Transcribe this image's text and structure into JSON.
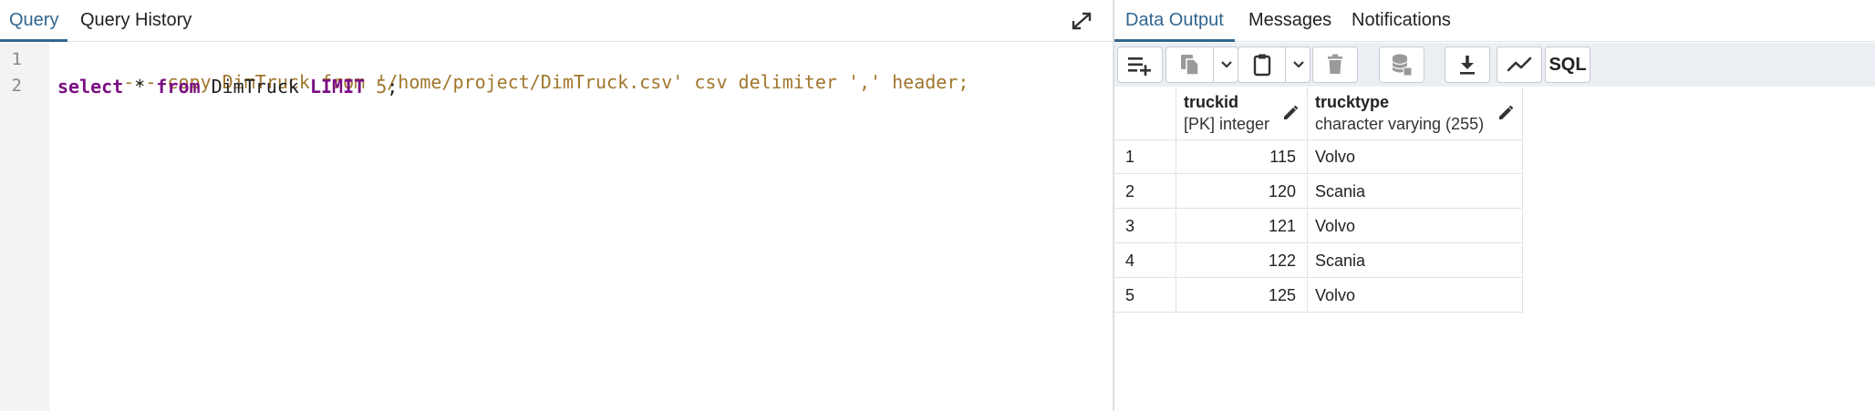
{
  "query_panel": {
    "tabs": [
      {
        "label": "Query",
        "active": true
      },
      {
        "label": "Query History",
        "active": false
      }
    ],
    "expand_icon": "expand-icon"
  },
  "editor": {
    "line_numbers": [
      "1",
      "2"
    ],
    "line1": "--- copy DimTruck from '/home/project/DimTruck.csv' csv delimiter ',' header;",
    "line2": {
      "kw_select": "select",
      "star": " * ",
      "kw_from": "from",
      "table": " DimTruck ",
      "kw_limit": "LIMIT",
      "space": " ",
      "num": "5",
      "semi": ";"
    }
  },
  "output_panel": {
    "tabs": [
      {
        "label": "Data Output",
        "active": true
      },
      {
        "label": "Messages",
        "active": false
      },
      {
        "label": "Notifications",
        "active": false
      }
    ],
    "toolbar": {
      "add_row_icon": "add-row-icon",
      "copy_icon": "copy-icon",
      "paste_icon": "paste-icon",
      "delete_icon": "delete-icon",
      "save_data_icon": "database-save-icon",
      "download_icon": "download-icon",
      "graph_icon": "graph-icon",
      "sql_label": "SQL"
    },
    "columns": [
      {
        "name": "truckid",
        "type": "[PK] integer"
      },
      {
        "name": "trucktype",
        "type": "character varying (255)"
      }
    ],
    "rows": [
      {
        "n": "1",
        "truckid": "115",
        "trucktype": "Volvo"
      },
      {
        "n": "2",
        "truckid": "120",
        "trucktype": "Scania"
      },
      {
        "n": "3",
        "truckid": "121",
        "trucktype": "Volvo"
      },
      {
        "n": "4",
        "truckid": "122",
        "trucktype": "Scania"
      },
      {
        "n": "5",
        "truckid": "125",
        "trucktype": "Volvo"
      }
    ]
  },
  "colors": {
    "accent": "#326690",
    "keyword": "#7a0f83",
    "comment": "#a0772d"
  }
}
